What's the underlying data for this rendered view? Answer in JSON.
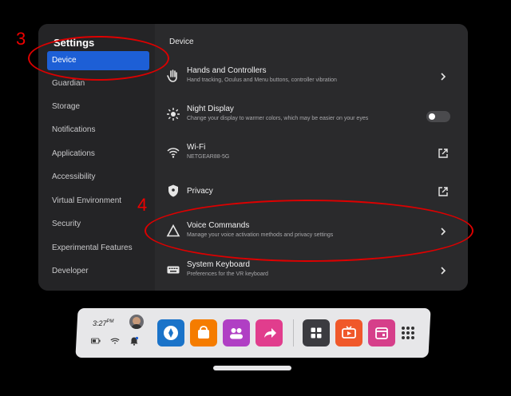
{
  "settings": {
    "title": "Settings",
    "sidebar": [
      {
        "label": "Device"
      },
      {
        "label": "Guardian"
      },
      {
        "label": "Storage"
      },
      {
        "label": "Notifications"
      },
      {
        "label": "Applications"
      },
      {
        "label": "Accessibility"
      },
      {
        "label": "Virtual Environment"
      },
      {
        "label": "Security"
      },
      {
        "label": "Experimental Features"
      },
      {
        "label": "Developer"
      }
    ],
    "section_title": "Device",
    "rows": [
      {
        "title": "Hands and Controllers",
        "subtitle": "Hand tracking, Oculus and Menu buttons, controller vibration"
      },
      {
        "title": "Night Display",
        "subtitle": "Change your display to warmer colors, which may be easier on your eyes"
      },
      {
        "title": "Wi-Fi",
        "subtitle": "NETGEAR88-5G"
      },
      {
        "title": "Privacy",
        "subtitle": ""
      },
      {
        "title": "Voice Commands",
        "subtitle": "Manage your voice activation methods and privacy settings"
      },
      {
        "title": "System Keyboard",
        "subtitle": "Preferences for the VR keyboard"
      }
    ]
  },
  "annotations": {
    "num3": "3",
    "num4": "4"
  },
  "taskbar": {
    "time": "3:27",
    "ampm": "PM"
  },
  "colors": {
    "accent": "#1d5fd6",
    "annotation": "#d00000"
  }
}
